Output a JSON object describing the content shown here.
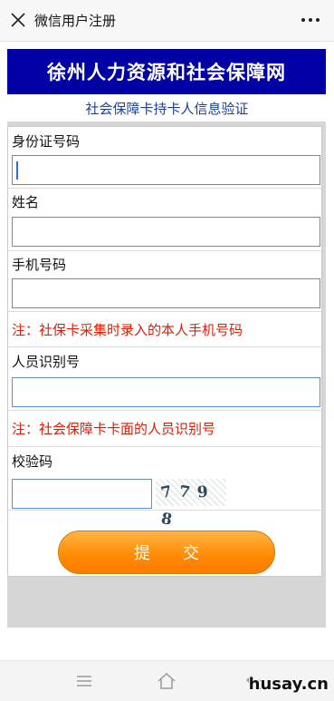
{
  "window": {
    "title": "微信用户注册",
    "close_icon": "close-icon",
    "more_icon": "more-icon"
  },
  "banner": {
    "text": "徐州人力资源和社会保障网"
  },
  "subtitle": "社会保障卡持卡人信息验证",
  "form": {
    "id_label": "身份证号码",
    "id_value": "",
    "name_label": "姓名",
    "name_value": "",
    "phone_label": "手机号码",
    "phone_value": "",
    "phone_note": "注：社保卡采集时录入的本人手机号码",
    "person_id_label": "人员识别号",
    "person_id_value": "",
    "person_id_note": "注：社会保障卡卡面的人员识别号",
    "captcha_label": "校验码",
    "captcha_value": "",
    "captcha_chars": [
      "7",
      "7",
      "9",
      "8"
    ],
    "submit_label": "提交"
  },
  "nav": {
    "icons": [
      "menu-icon",
      "home-icon",
      "back-icon"
    ]
  },
  "watermark": "husay.cn",
  "colors": {
    "banner": "#0000a4",
    "subtitle": "#1a3f9e",
    "note": "#d81e06",
    "submit": "#ff8a00",
    "input_border": "#5a8fcb"
  }
}
